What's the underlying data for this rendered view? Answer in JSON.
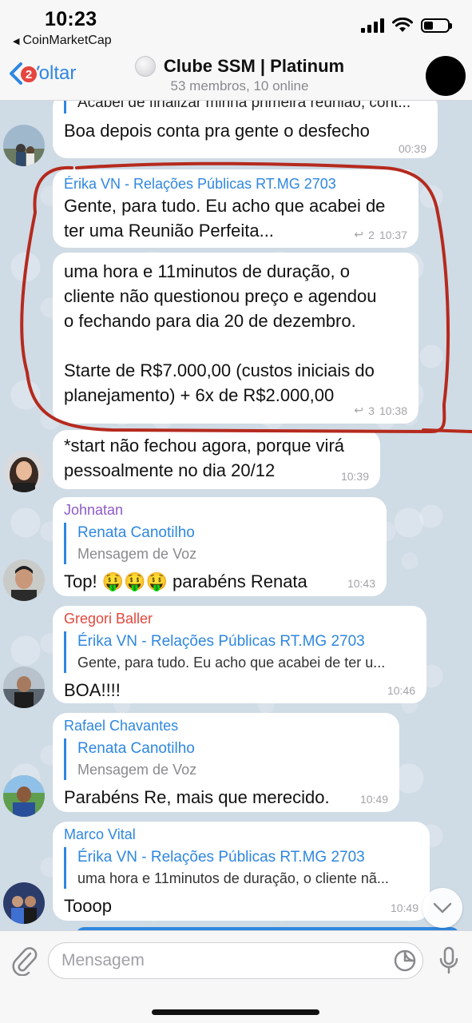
{
  "status_bar": {
    "time": "10:23",
    "back_app": "CoinMarketCap"
  },
  "header": {
    "back_label": "Voltar",
    "unread_badge": "2",
    "title": "Clube SSM | Platinum",
    "subtitle": "53 membros, 10 online"
  },
  "colors": {
    "accent": "#2f87e0",
    "badge": "#e5453d",
    "annotation_circle": "#b52a1e",
    "chat_background": "#cfdbe5"
  },
  "messages": [
    {
      "quote_text": "Acabei de finalizar minha primeira reunião, cont...",
      "text": "Boa depois conta pra gente o desfecho",
      "time": "00:39"
    },
    {
      "sender": "Érika VN - Relações Públicas RT.MG 2703",
      "sender_color": "#2f87e0",
      "text": "Gente, para tudo. Eu acho que acabei de\nter uma Reunião Perfeita...",
      "replies": "2",
      "time": "10:37"
    },
    {
      "text": "uma hora e 11minutos de duração, o\ncliente não questionou  preço e agendou\no fechando para dia 20 de dezembro.\n\nStarte de R$7.000,00 (custos iniciais do\nplanejamento) + 6x de R$2.000,00",
      "replies": "3",
      "time": "10:38"
    },
    {
      "text": "*start não fechou agora, porque virá\npessoalmente no dia 20/12",
      "time": "10:39"
    },
    {
      "sender": "Johnatan",
      "sender_color": "#8e5ac8",
      "quote_name": "Renata Canotilho",
      "quote_text": "Mensagem de Voz",
      "text": "Top! 🤑🤑🤑 parabéns Renata",
      "time": "10:43"
    },
    {
      "sender": "Gregori Baller",
      "sender_color": "#e0483d",
      "quote_name": "Érika VN - Relações Públicas RT.MG 2703",
      "quote_text": "Gente, para tudo. Eu acho que acabei de ter u...",
      "text": "BOA!!!!",
      "time": "10:46"
    },
    {
      "sender": "Rafael Chavantes",
      "sender_color": "#2f87e0",
      "quote_name": "Renata Canotilho",
      "quote_text": "Mensagem de Voz",
      "text": "Parabéns Re, mais que merecido.",
      "time": "10:49"
    },
    {
      "sender": "Marco Vital",
      "sender_color": "#2f87e0",
      "quote_name": "Érika VN - Relações Públicas RT.MG 2703",
      "quote_text": "uma hora e 11minutos de duração, o cliente nã...",
      "text": "Tooop",
      "time": "10:49"
    }
  ],
  "input": {
    "placeholder": "Mensagem"
  },
  "icons": [
    "back-chevron-icon",
    "signal-icon",
    "wifi-icon",
    "battery-icon",
    "group-icon",
    "reply-count-icon",
    "scroll-down-chevron-icon",
    "paperclip-icon",
    "sticker-icon",
    "microphone-icon"
  ]
}
